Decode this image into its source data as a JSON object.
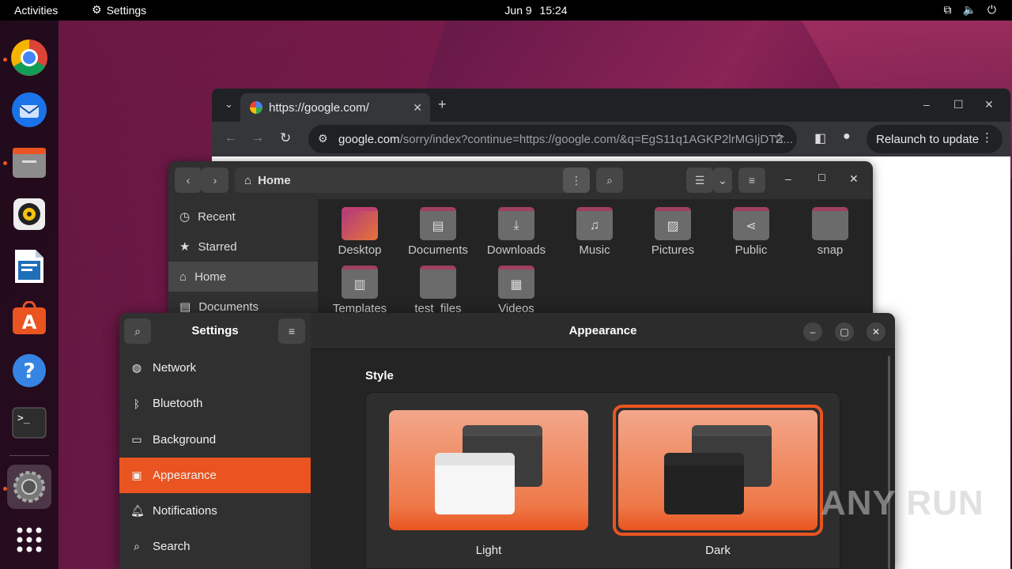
{
  "topbar": {
    "activities": "Activities",
    "app_name": "Settings",
    "date": "Jun 9",
    "time": "15:24",
    "icons": [
      "network-icon",
      "volume-icon",
      "power-icon"
    ]
  },
  "dock": {
    "apps": [
      {
        "name": "chrome-icon",
        "running": true
      },
      {
        "name": "thunderbird-icon",
        "running": false
      },
      {
        "name": "files-icon",
        "running": true
      },
      {
        "name": "rhythmbox-icon",
        "running": false
      },
      {
        "name": "writer-icon",
        "running": false
      },
      {
        "name": "app-center-icon",
        "running": false
      },
      {
        "name": "help-icon",
        "running": false
      },
      {
        "name": "terminal-icon",
        "running": false
      },
      {
        "name": "settings-icon",
        "running": true
      }
    ],
    "show_apps": "apps-grid-icon"
  },
  "chrome": {
    "tab_title": "https://google.com/",
    "url_host": "google.com",
    "url_path": "/sorry/index?continue=https://google.com/&q=EgS11q1AGKP2lrMGIjDTZ...",
    "relaunch": "Relaunch to update",
    "accent": "#e95420"
  },
  "files": {
    "location": "Home",
    "sidebar": [
      {
        "label": "Recent",
        "icon": "clock-icon"
      },
      {
        "label": "Starred",
        "icon": "star-icon"
      },
      {
        "label": "Home",
        "icon": "home-icon",
        "selected": true
      },
      {
        "label": "Documents",
        "icon": "document-icon"
      }
    ],
    "folders": [
      {
        "label": "Desktop",
        "glyph": ""
      },
      {
        "label": "Documents",
        "glyph": "▤"
      },
      {
        "label": "Downloads",
        "glyph": "⤓"
      },
      {
        "label": "Music",
        "glyph": "♫"
      },
      {
        "label": "Pictures",
        "glyph": "▨"
      },
      {
        "label": "Public",
        "glyph": "⋖"
      },
      {
        "label": "snap",
        "glyph": ""
      },
      {
        "label": "Templates",
        "glyph": "▥"
      },
      {
        "label": "test_files",
        "glyph": ""
      },
      {
        "label": "Videos",
        "glyph": "▦"
      }
    ]
  },
  "settings": {
    "title": "Settings",
    "panel_title": "Appearance",
    "nav": [
      {
        "label": "Network",
        "icon": "globe-icon",
        "glyph": "◍"
      },
      {
        "label": "Bluetooth",
        "icon": "bluetooth-icon",
        "glyph": "ᛒ"
      },
      {
        "label": "Background",
        "icon": "monitor-icon",
        "glyph": "▭"
      },
      {
        "label": "Appearance",
        "icon": "appearance-icon",
        "glyph": "▣",
        "selected": true
      },
      {
        "label": "Notifications",
        "icon": "bell-icon",
        "glyph": "♫"
      },
      {
        "label": "Search",
        "icon": "search-icon",
        "glyph": "⌕"
      }
    ],
    "style_heading": "Style",
    "themes": [
      {
        "label": "Light",
        "selected": false
      },
      {
        "label": "Dark",
        "selected": true
      }
    ]
  },
  "watermark": "ANY RUN"
}
